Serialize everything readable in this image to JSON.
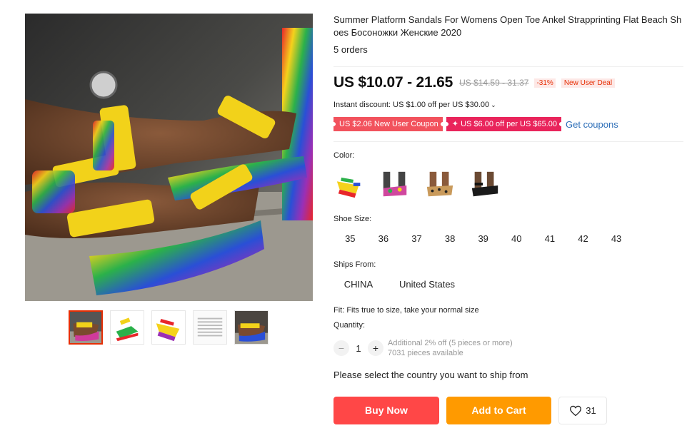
{
  "product": {
    "title": "Summer Platform Sandals For Womens Open Toe Ankel Strapprinting Flat Beach Shoes Босоножки Женские 2020",
    "orders": "5 orders"
  },
  "price": {
    "current": "US $10.07 - 21.65",
    "original": "US $14.59 - 31.37",
    "discount": "-31%",
    "deal_badge": "New User Deal"
  },
  "instant_discount": {
    "text": "Instant discount: US $1.00 off per US $30.00",
    "chevron": "⌄"
  },
  "coupons": {
    "items": [
      {
        "label": "US $2.06 New User Coupon"
      },
      {
        "label": "✦ US $6.00 off per US $65.00"
      }
    ],
    "get_label": "Get coupons"
  },
  "color": {
    "label": "Color:",
    "options": [
      {
        "icon": "tie-dye-sandal-thumb"
      },
      {
        "icon": "pink-floral-sandal-thumb"
      },
      {
        "icon": "leopard-sandal-thumb"
      },
      {
        "icon": "black-sandal-thumb"
      }
    ]
  },
  "size": {
    "label": "Shoe Size:",
    "options": [
      "35",
      "36",
      "37",
      "38",
      "39",
      "40",
      "41",
      "42",
      "43"
    ]
  },
  "ships_from": {
    "label": "Ships From:",
    "options": [
      "CHINA",
      "United States"
    ]
  },
  "fit": "Fit: Fits true to size, take your normal size",
  "quantity": {
    "label": "Quantity:",
    "value": "1",
    "minus": "−",
    "plus": "+",
    "note_line1": "Additional 2% off (5 pieces or more)",
    "note_line2": "7031 pieces available"
  },
  "ship_note": "Please select the country you want to ship from",
  "actions": {
    "buy_now": "Buy Now",
    "add_to_cart": "Add to Cart",
    "wish_count": "31"
  },
  "colors": {
    "buy": "#ff4747",
    "cart": "#ff9a00",
    "coupon_link": "#2e6fb8",
    "discount_red": "#e62e04"
  }
}
